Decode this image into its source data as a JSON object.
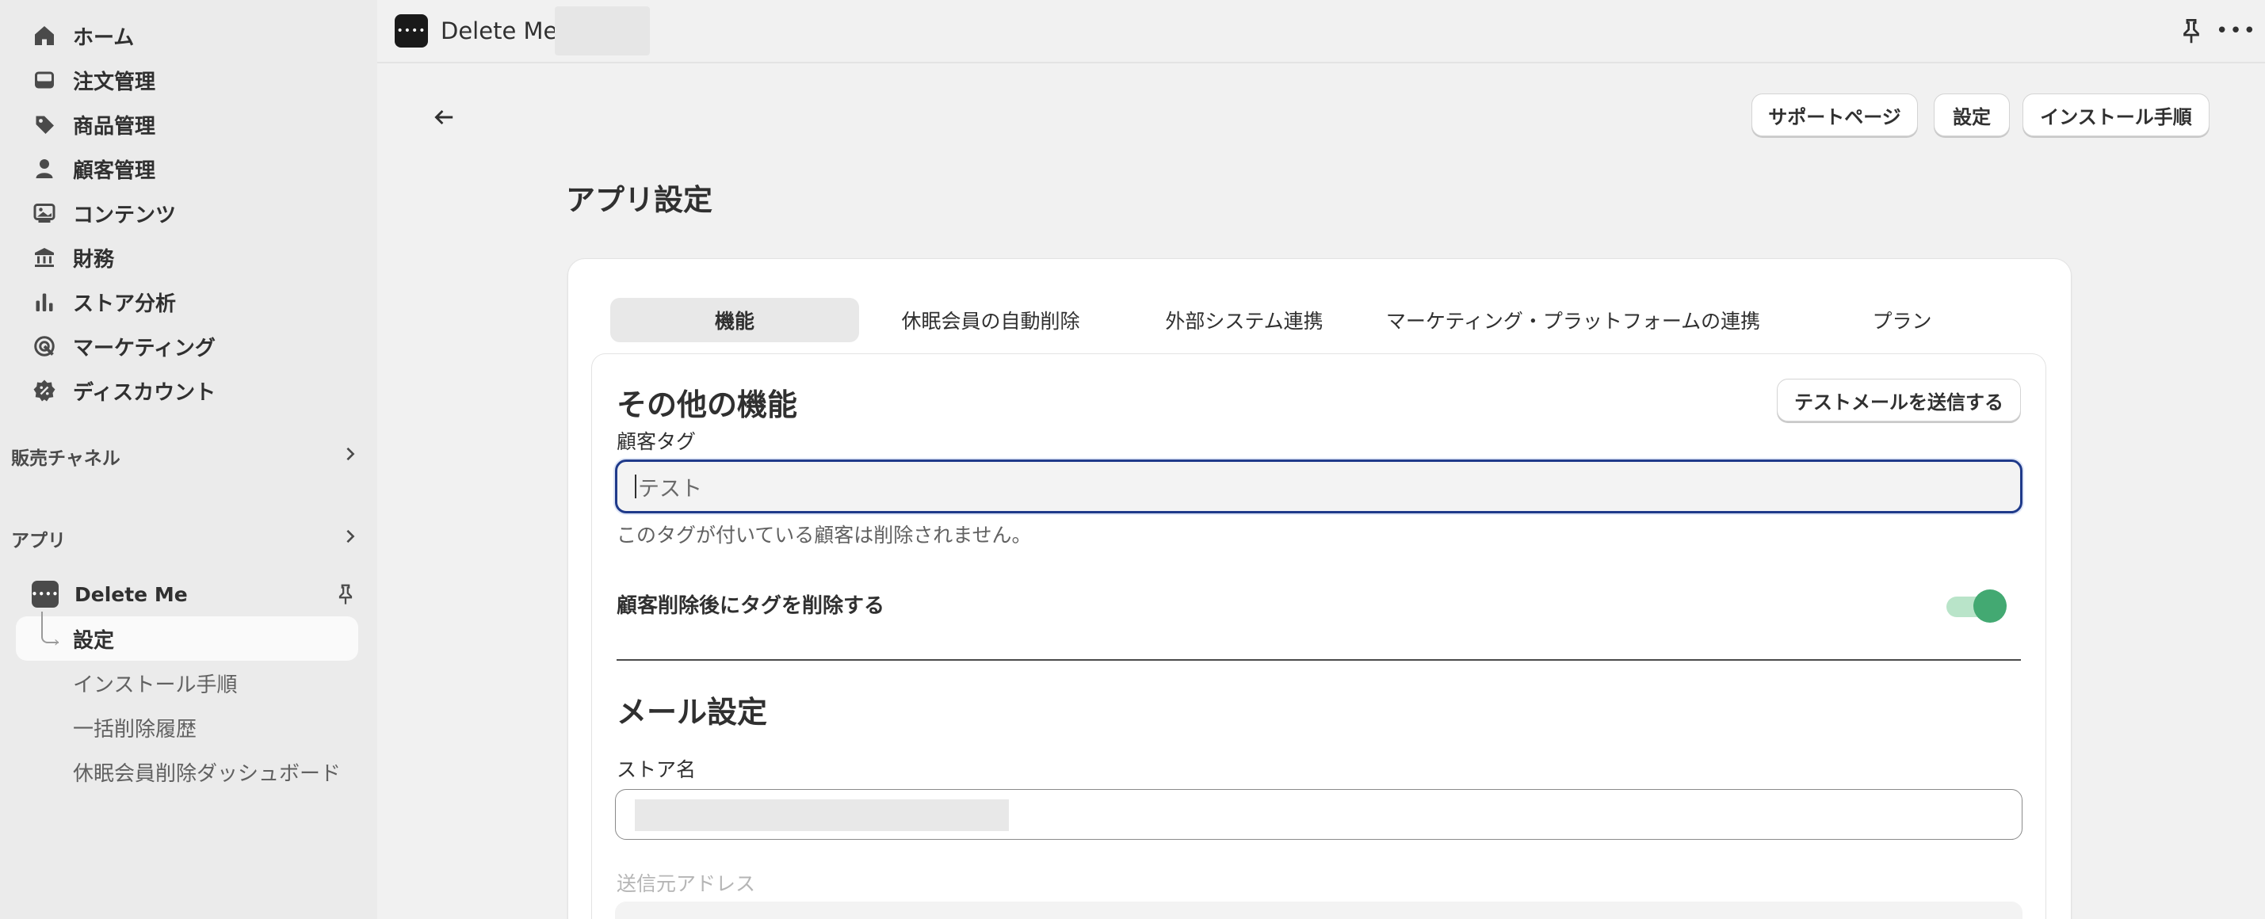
{
  "sidebar": {
    "nav": [
      {
        "label": "ホーム",
        "icon": "home-icon"
      },
      {
        "label": "注文管理",
        "icon": "inbox-icon"
      },
      {
        "label": "商品管理",
        "icon": "tag-icon"
      },
      {
        "label": "顧客管理",
        "icon": "person-icon"
      },
      {
        "label": "コンテンツ",
        "icon": "image-icon"
      },
      {
        "label": "財務",
        "icon": "bank-icon"
      },
      {
        "label": "ストア分析",
        "icon": "bar-chart-icon"
      },
      {
        "label": "マーケティング",
        "icon": "target-icon"
      },
      {
        "label": "ディスカウント",
        "icon": "discount-icon"
      }
    ],
    "sales_channels_label": "販売チャネル",
    "apps_label": "アプリ",
    "app": {
      "name": "Delete Me",
      "sub_items": [
        {
          "label": "設定",
          "active": true
        },
        {
          "label": "インストール手順",
          "active": false
        },
        {
          "label": "一括削除履歴",
          "active": false
        },
        {
          "label": "休眠会員削除ダッシュボード",
          "active": false
        }
      ]
    }
  },
  "topbar": {
    "app_title": "Delete Me"
  },
  "header": {
    "buttons": {
      "support": "サポートページ",
      "settings": "設定",
      "install": "インストール手順"
    },
    "page_title": "アプリ設定"
  },
  "tabs": [
    {
      "label": "機能",
      "active": true
    },
    {
      "label": "休眠会員の自動削除",
      "active": false
    },
    {
      "label": "外部システム連携",
      "active": false
    },
    {
      "label": "マーケティング・プラットフォームの連携",
      "active": false
    },
    {
      "label": "プラン",
      "active": false
    }
  ],
  "other_features": {
    "heading": "その他の機能",
    "test_email_button": "テストメールを送信する",
    "customer_tag_label": "顧客タグ",
    "customer_tag_placeholder": "テスト",
    "help_text": "このタグが付いている顧客は削除されません。",
    "delete_tag_label": "顧客削除後にタグを削除する",
    "delete_tag_enabled": true
  },
  "mail_settings": {
    "heading": "メール設定",
    "store_name_label": "ストア名",
    "sender_address_label": "送信元アドレス"
  },
  "colors": {
    "toggle_on": "#43a972",
    "focus_ring": "#1f3a8a"
  }
}
